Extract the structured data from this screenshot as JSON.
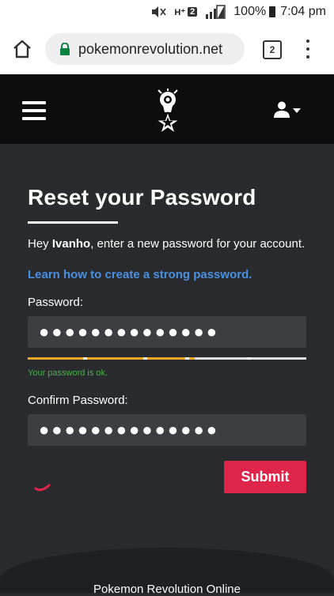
{
  "status_bar": {
    "network_badge": "2",
    "battery": "100%",
    "time": "7:04 pm"
  },
  "browser": {
    "url": "pokemonrevolution.net",
    "tab_count": "2"
  },
  "header": {
    "logo_icon": "pokemon-revolution-logo",
    "menu_icon": "hamburger-icon",
    "user_icon": "user-icon"
  },
  "form": {
    "title": "Reset your Password",
    "intro_prefix": "Hey ",
    "intro_name": "Ivanho",
    "intro_suffix": ", enter a new password for your account.",
    "help_link": "Learn how to create a strong password.",
    "password_label": "Password:",
    "password_value": "●●●●●●●●●●●●●●",
    "strength_message": "Your password is ok.",
    "strength_level": 0.6,
    "confirm_label": "Confirm Password:",
    "confirm_value": "●●●●●●●●●●●●●●",
    "submit_label": "Submit"
  },
  "footer": {
    "text": "Pokemon Revolution Online"
  },
  "colors": {
    "accent": "#e0254a",
    "link": "#4a90e2",
    "success": "#4caf50",
    "strength_fill": "#f5a623"
  }
}
